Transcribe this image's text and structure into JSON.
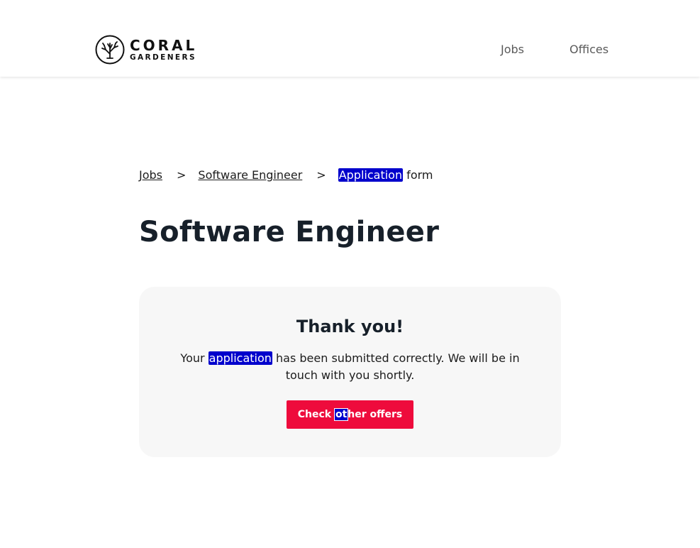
{
  "brand": {
    "name_line1": "CORAL",
    "name_line2": "GARDENERS"
  },
  "nav": {
    "items": [
      {
        "label": "Jobs"
      },
      {
        "label": "Offices"
      }
    ]
  },
  "breadcrumb": {
    "items": [
      {
        "label": "Jobs"
      },
      {
        "label": "Software Engineer"
      }
    ],
    "separator": ">",
    "current_highlight": "Application",
    "current_rest": " form"
  },
  "page": {
    "title": "Software Engineer"
  },
  "confirmation": {
    "title": "Thank you!",
    "message_prefix": "Your ",
    "message_highlight": "application",
    "message_suffix": " has been submitted correctly. We will be in touch with you shortly.",
    "button_part1": "Check ",
    "button_highlight": "ot",
    "button_part2": "her offers"
  },
  "colors": {
    "accent": "#ee0b3c",
    "highlight": "#0000cc",
    "card_bg": "#f7f7f7",
    "title_text": "#17202a"
  },
  "icons": {
    "logo": "coral-icon"
  }
}
